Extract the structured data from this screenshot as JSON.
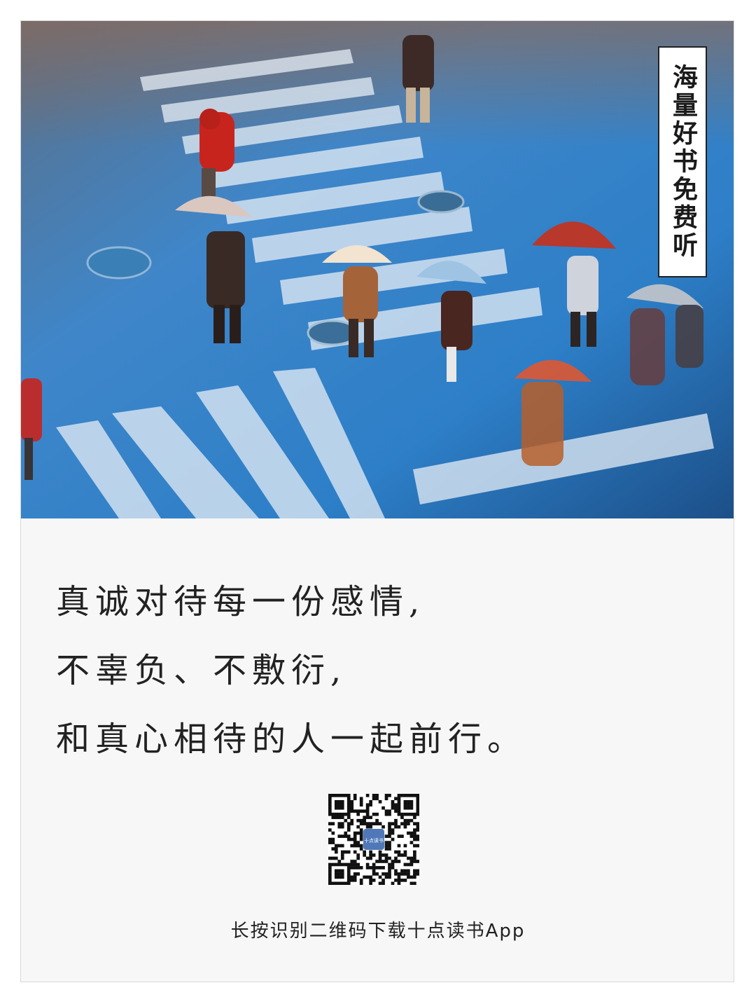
{
  "badge": {
    "text": "海量好书免费听"
  },
  "quote": {
    "lines": [
      "真诚对待每一份感情,",
      "不辜负、不敷衍,",
      "和真心相待的人一起前行。"
    ]
  },
  "qr": {
    "center_logo_text": "十点读书"
  },
  "caption": {
    "text": "长按识别二维码下载十点读书App"
  }
}
